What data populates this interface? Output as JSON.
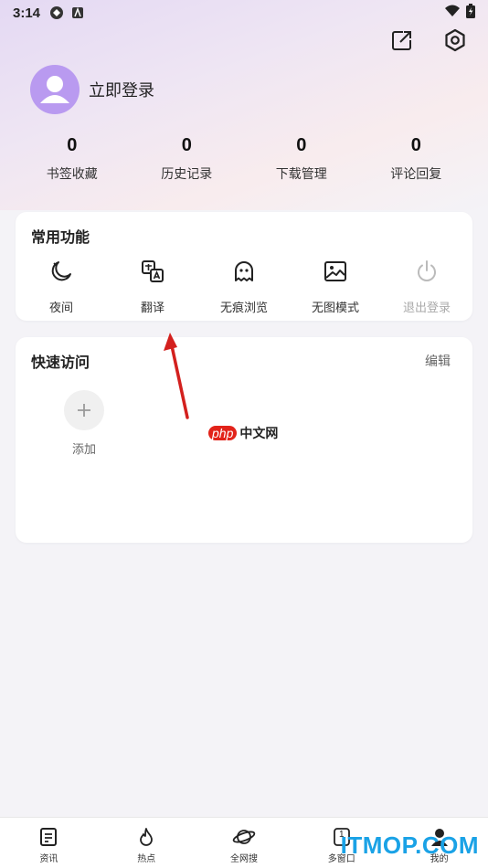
{
  "status_bar": {
    "time": "3:14"
  },
  "profile": {
    "login_label": "立即登录"
  },
  "stats": [
    {
      "value": "0",
      "label": "书签收藏"
    },
    {
      "value": "0",
      "label": "历史记录"
    },
    {
      "value": "0",
      "label": "下载管理"
    },
    {
      "value": "0",
      "label": "评论回复"
    }
  ],
  "common": {
    "title": "常用功能",
    "items": [
      {
        "label": "夜间",
        "icon": "moon-icon"
      },
      {
        "label": "翻译",
        "icon": "translate-icon"
      },
      {
        "label": "无痕浏览",
        "icon": "ghost-icon"
      },
      {
        "label": "无图模式",
        "icon": "image-icon"
      },
      {
        "label": "退出登录",
        "icon": "power-icon"
      }
    ]
  },
  "quick": {
    "title": "快速访问",
    "edit_label": "编辑",
    "add_label": "添加"
  },
  "bottom_nav": [
    {
      "label": "资讯",
      "icon": "news-icon"
    },
    {
      "label": "热点",
      "icon": "fire-icon"
    },
    {
      "label": "全网搜",
      "icon": "planet-icon"
    },
    {
      "label": "多窗口",
      "icon": "windows-icon",
      "count": "1"
    },
    {
      "label": "我的",
      "icon": "user-icon"
    }
  ],
  "watermarks": {
    "php_part1": "php",
    "php_part2": "中文网",
    "itmop": "ITMOP.COM"
  },
  "colors": {
    "avatar": "#b99af0",
    "accent_arrow": "#d3201e",
    "itmop_blue": "#1aa2e6"
  }
}
